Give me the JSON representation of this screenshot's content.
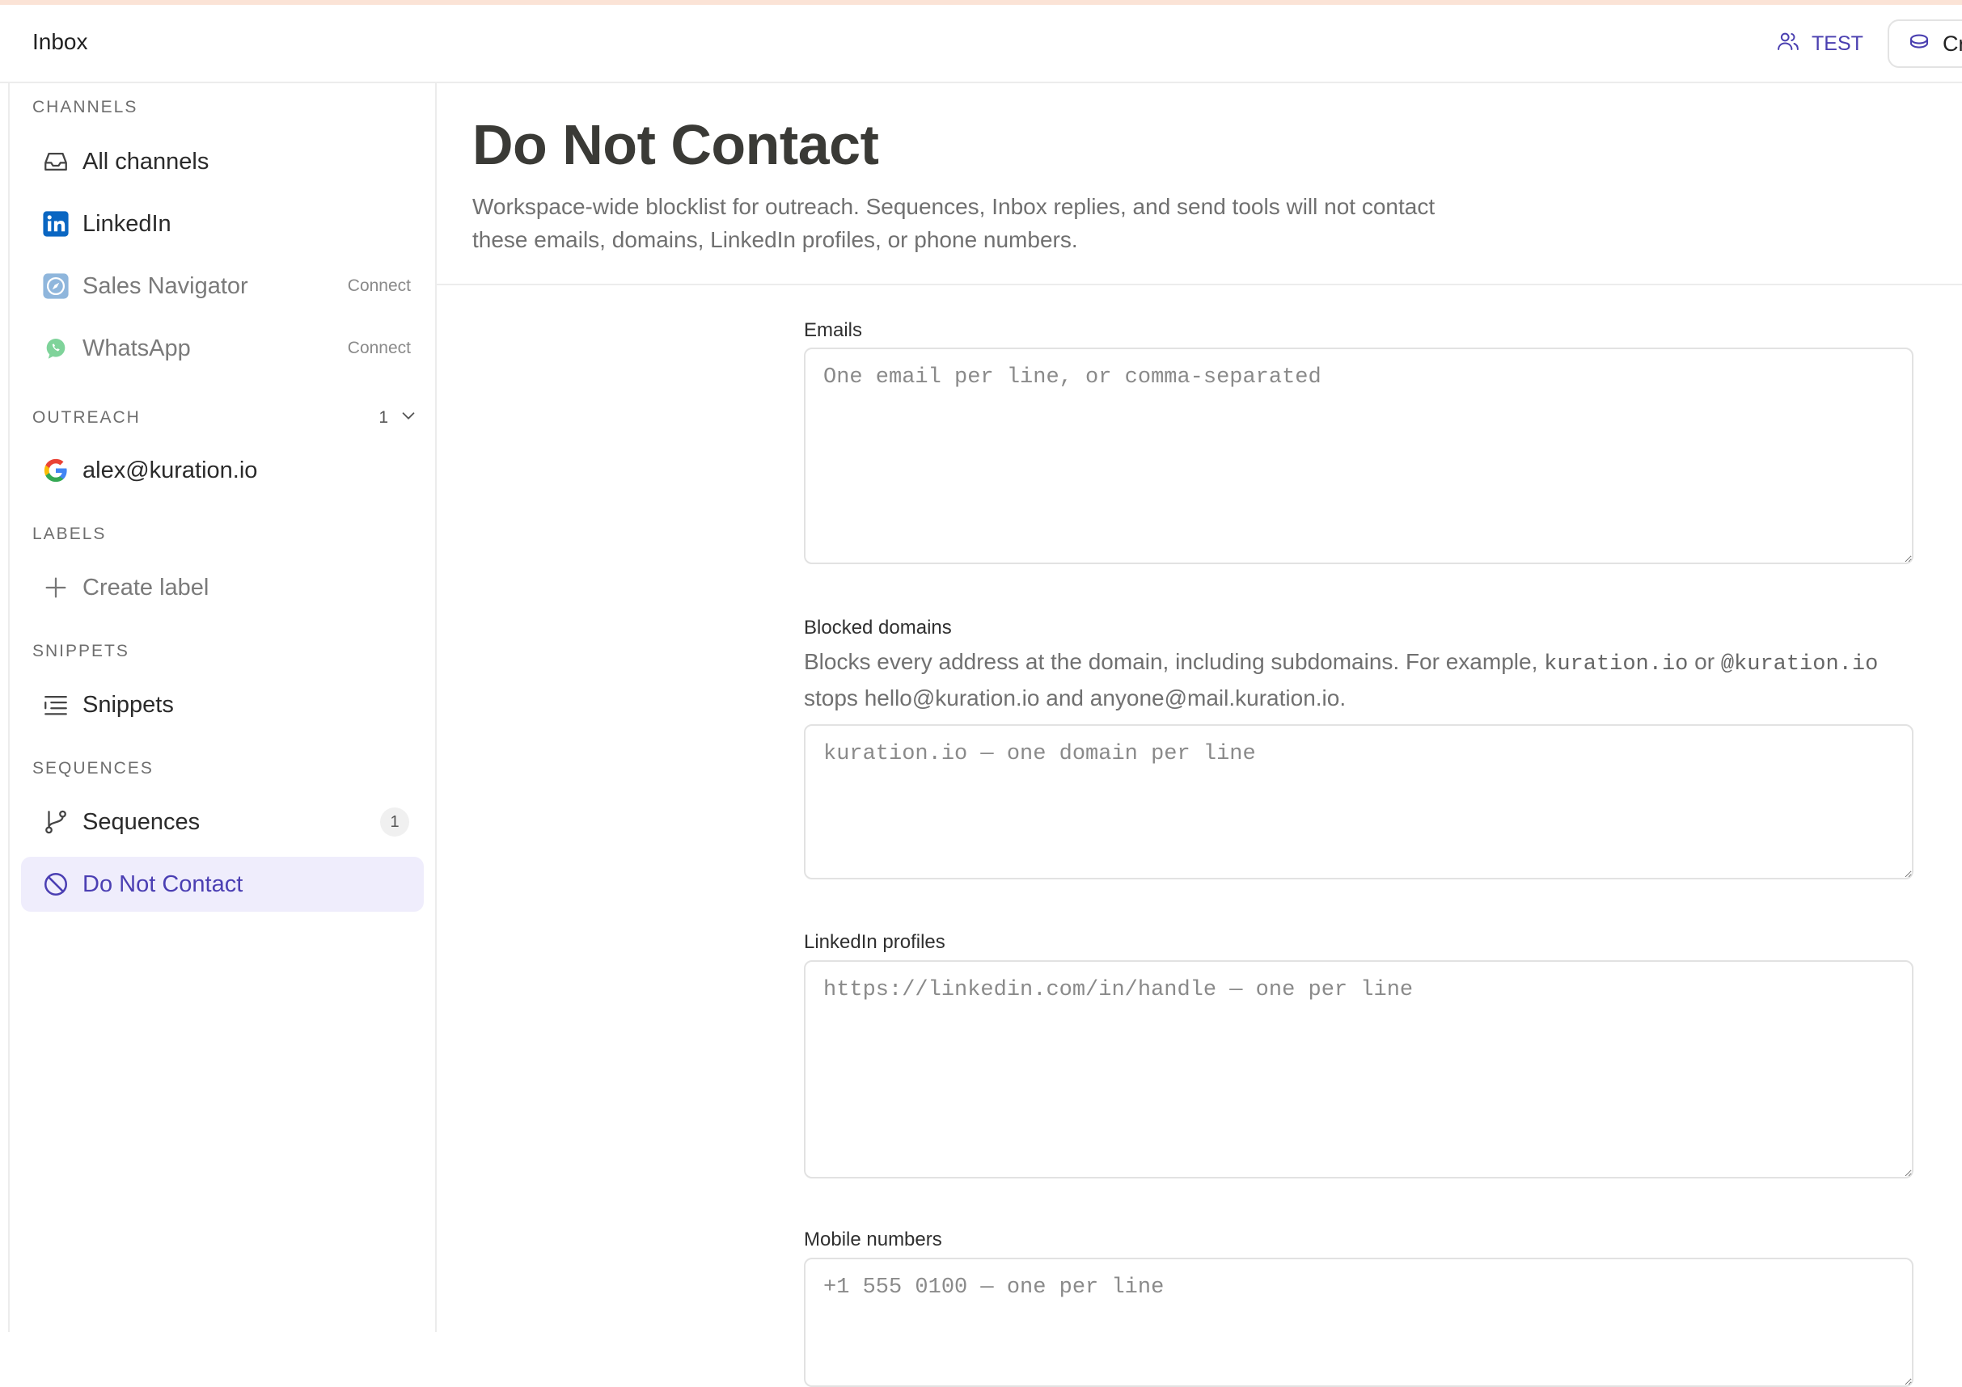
{
  "header": {
    "title": "Inbox",
    "workspace_label": "TEST",
    "credits_label": "Cr"
  },
  "sidebar": {
    "channels_heading": "CHANNELS",
    "channels": [
      {
        "label": "All channels",
        "icon": "inbox-icon"
      },
      {
        "label": "LinkedIn",
        "icon": "linkedin-icon"
      },
      {
        "label": "Sales Navigator",
        "icon": "compass-icon",
        "action": "Connect"
      },
      {
        "label": "WhatsApp",
        "icon": "whatsapp-icon",
        "action": "Connect"
      }
    ],
    "outreach_heading": "OUTREACH",
    "outreach_count": "1",
    "outreach_account": "alex@kuration.io",
    "labels_heading": "LABELS",
    "create_label": "Create label",
    "snippets_heading": "SNIPPETS",
    "snippets_item": "Snippets",
    "sequences_heading": "SEQUENCES",
    "sequences_item": "Sequences",
    "sequences_count": "1",
    "dnc_item": "Do Not Contact"
  },
  "main": {
    "title": "Do Not Contact",
    "description": "Workspace-wide blocklist for outreach. Sequences, Inbox replies, and send tools will not contact these emails, domains, LinkedIn profiles, or phone numbers.",
    "emails": {
      "label": "Emails",
      "placeholder": "One email per line, or comma-separated",
      "value": ""
    },
    "domains": {
      "label": "Blocked domains",
      "help_prefix": "Blocks every address at the domain, including subdomains. For example, ",
      "help_code1": "kuration.io",
      "help_mid": " or ",
      "help_code2": "@kuration.io",
      "help_suffix": " stops hello@kuration.io and anyone@mail.kuration.io.",
      "placeholder": "kuration.io — one domain per line",
      "value": ""
    },
    "linkedin": {
      "label": "LinkedIn profiles",
      "placeholder": "https://linkedin.com/in/handle — one per line",
      "value": ""
    },
    "mobile": {
      "label": "Mobile numbers",
      "placeholder": "+1 555 0100 — one per line",
      "value": ""
    }
  },
  "colors": {
    "accent": "#4b3fb3",
    "active_bg": "#efedfc",
    "linkedin_blue": "#0a66c2"
  }
}
